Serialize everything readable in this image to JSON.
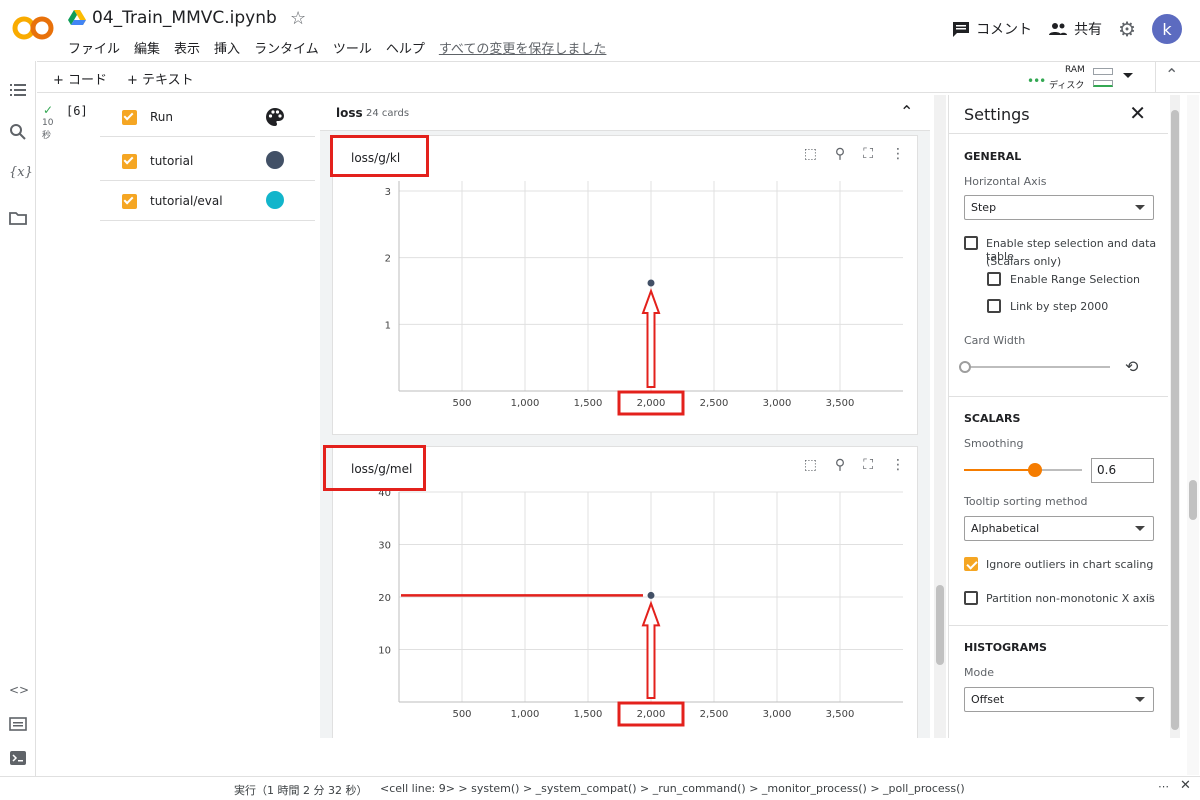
{
  "header": {
    "logo_text": "CO",
    "notebook_title": "04_Train_MMVC.ipynb",
    "menu": [
      "ファイル",
      "編集",
      "表示",
      "挿入",
      "ランタイム",
      "ツール",
      "ヘルプ"
    ],
    "save_status": "すべての変更を保存しました",
    "comment_label": "コメント",
    "share_label": "共有",
    "avatar_letter": "k"
  },
  "toolbar": {
    "add_code": "+ コード",
    "add_text": "+ テキスト",
    "ram_label": "RAM",
    "disk_label": "ディスク"
  },
  "cell": {
    "execution_count": "[6]",
    "duration_value": "10",
    "duration_unit": "秒"
  },
  "runs": [
    {
      "label": "Run",
      "icon": "palette-icon"
    },
    {
      "label": "tutorial",
      "color": "#425066"
    },
    {
      "label": "tutorial/eval",
      "color": "#12b5cb"
    }
  ],
  "main": {
    "group_title": "loss",
    "group_count": "24 cards"
  },
  "chart_data": [
    {
      "type": "line",
      "title": "loss/g/kl",
      "x_ticks": [
        "500",
        "1,000",
        "1,500",
        "2,000",
        "2,500",
        "3,000",
        "3,500"
      ],
      "y_ticks": [
        "1",
        "2",
        "3"
      ],
      "xlim": [
        0,
        4000
      ],
      "ylim": [
        0,
        3.15
      ],
      "series": [
        {
          "points": [
            [
              2000,
              1.62
            ]
          ],
          "color": "#425066"
        }
      ],
      "highlight_label": "2,000"
    },
    {
      "type": "line",
      "title": "loss/g/mel",
      "x_ticks": [
        "500",
        "1,000",
        "1,500",
        "2,000",
        "2,500",
        "3,000",
        "3,500"
      ],
      "y_ticks": [
        "10",
        "20",
        "30",
        "40"
      ],
      "xlim": [
        0,
        4000
      ],
      "ylim": [
        0,
        40
      ],
      "series": [
        {
          "points": [
            [
              2000,
              20.3
            ]
          ],
          "color": "#425066"
        }
      ],
      "highlight_label": "2,000"
    }
  ],
  "settings": {
    "title": "Settings",
    "general": "GENERAL",
    "horizontal_axis_label": "Horizontal Axis",
    "horizontal_axis_value": "Step",
    "enable_step_line1": "Enable step selection and data table",
    "enable_step_line2": "(Scalars only)",
    "enable_range": "Enable Range Selection",
    "link_by_step": "Link by step 2000",
    "card_width_label": "Card Width",
    "scalars": "SCALARS",
    "smoothing_label": "Smoothing",
    "smoothing_value": "0.6",
    "smoothing_fraction": 0.6,
    "tooltip_label": "Tooltip sorting method",
    "tooltip_value": "Alphabetical",
    "ignore_outliers": "Ignore outliers in chart scaling",
    "partition": "Partition non-monotonic X axis",
    "histograms": "HISTOGRAMS",
    "mode_label": "Mode",
    "mode_value": "Offset"
  },
  "status": {
    "exec_text": "実行（1 時間 2 分 32 秒）",
    "callstack": "<cell line: 9> > system() > _system_compat() > _run_command() > _monitor_process() > _poll_process()"
  },
  "colors": {
    "accent": "#f5a623",
    "highlight": "#e3211c"
  }
}
